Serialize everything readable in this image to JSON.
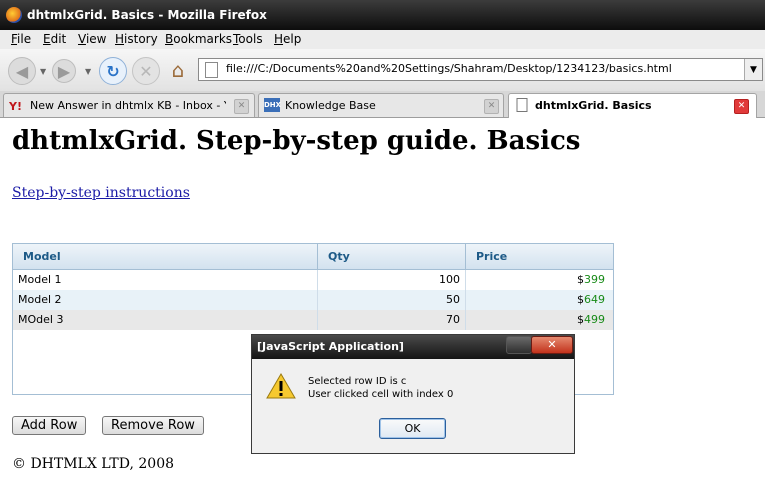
{
  "window": {
    "title": "dhtmlxGrid. Basics - Mozilla Firefox"
  },
  "menu": [
    "File",
    "Edit",
    "View",
    "History",
    "Bookmarks",
    "Tools",
    "Help"
  ],
  "nav": {
    "url": "file:///C:/Documents%20and%20Settings/Shahram/Desktop/1234123/basics.html"
  },
  "tabs": [
    {
      "label": "New Answer in dhtmlx KB - Inbox - Ya...",
      "favicon": "yahoo-icon",
      "active": false
    },
    {
      "label": "Knowledge Base",
      "favicon": "dhx-icon",
      "favicon_text": "DHX",
      "active": false
    },
    {
      "label": "dhtmlxGrid. Basics",
      "favicon": "page-icon",
      "active": true
    }
  ],
  "page": {
    "title": "dhtmlxGrid. Step-by-step guide. Basics",
    "link": "Step-by-step instructions",
    "add_row": "Add Row",
    "remove_row": "Remove Row",
    "footer": "© DHTMLX LTD, 2008"
  },
  "grid": {
    "columns": [
      "Model",
      "Qty",
      "Price"
    ],
    "rows": [
      {
        "model": "Model 1",
        "qty": "100",
        "currency": "$",
        "price": "399"
      },
      {
        "model": "Model 2",
        "qty": "50",
        "currency": "$",
        "price": "649"
      },
      {
        "model": "MOdel 3",
        "qty": "70",
        "currency": "$",
        "price": "499"
      }
    ],
    "colors": {
      "header_text": "#1d5a87",
      "price": "#178a17",
      "row_alt": "#e8f2f8",
      "row_selected": "#e8e8e8"
    }
  },
  "dialog": {
    "title": "[JavaScript Application]",
    "line1": "Selected row ID is c",
    "line2": "User clicked cell with index 0",
    "ok": "OK"
  }
}
